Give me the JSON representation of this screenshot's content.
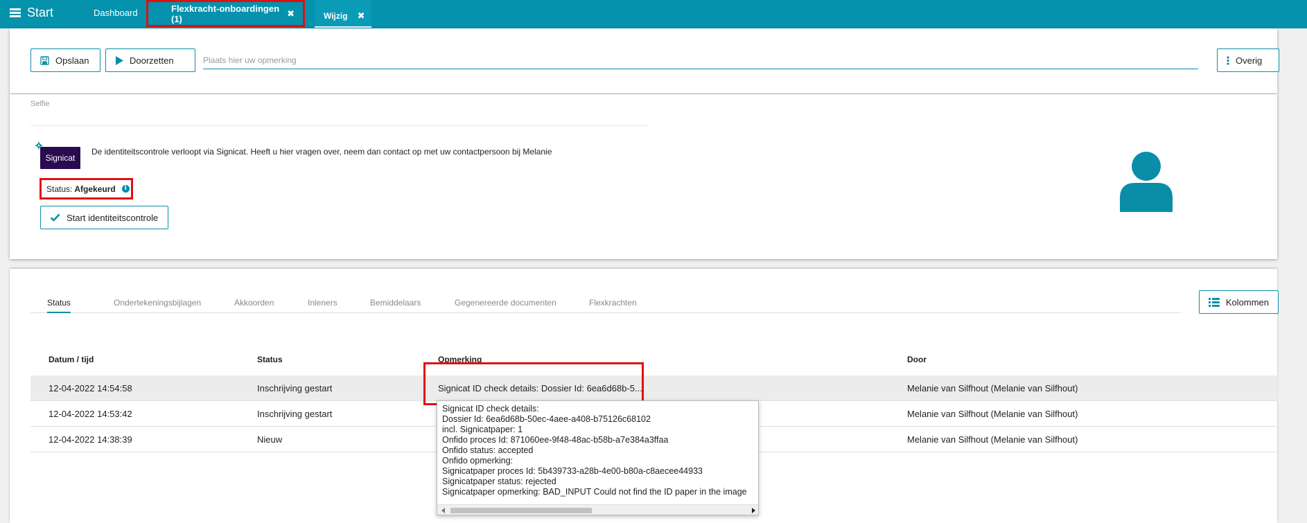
{
  "topbar": {
    "start_label": "Start",
    "tabs": [
      {
        "label": "Dashboard"
      },
      {
        "label": "Flexkracht-onboardingen (1)",
        "close": "✖"
      },
      {
        "label": "Wijzig",
        "close": "✖"
      }
    ],
    "bg_color": "#0492ad"
  },
  "toolbar": {
    "save_label": "Opslaan",
    "forward_label": "Doorzetten",
    "remark_placeholder": "Plaats hier uw opmerking",
    "more_label": "Overig"
  },
  "selfie": {
    "section_label": "Selfie",
    "logo_text": "Signicat",
    "info_text": "De identiteitscontrole verloopt via Signicat. Heeft u hier vragen over, neem dan contact op met uw contactpersoon bij Melanie",
    "status_label": "Status:",
    "status_value": "Afgekeurd",
    "start_button": "Start identiteitscontrole"
  },
  "detail_tabs": [
    {
      "label": "Status",
      "active": true
    },
    {
      "label": "Ondertekeningsbijlagen"
    },
    {
      "label": "Akkoorden"
    },
    {
      "label": "Inleners"
    },
    {
      "label": "Bemiddelaars"
    },
    {
      "label": "Gegenereerde documenten"
    },
    {
      "label": "Flexkrachten"
    }
  ],
  "columns_button": "Kolommen",
  "table": {
    "headers": [
      "Datum / tijd",
      "Status",
      "Opmerking",
      "Door"
    ],
    "rows": [
      {
        "datetime": "12-04-2022 14:54:58",
        "status": "Inschrijving gestart",
        "remark": "Signicat ID check details: Dossier Id: 6ea6d68b-5...",
        "by": "Melanie van Silfhout (Melanie van Silfhout)"
      },
      {
        "datetime": "12-04-2022 14:53:42",
        "status": "Inschrijving gestart",
        "remark": "",
        "by": "Melanie van Silfhout (Melanie van Silfhout)"
      },
      {
        "datetime": "12-04-2022 14:38:39",
        "status": "Nieuw",
        "remark": "",
        "by": "Melanie van Silfhout (Melanie van Silfhout)"
      }
    ]
  },
  "tooltip": {
    "lines": [
      "Signicat ID check details:",
      "Dossier Id: 6ea6d68b-50ec-4aee-a408-b75126c68102",
      "incl. Signicatpaper: 1",
      "Onfido proces Id: 871060ee-9f48-48ac-b58b-a7e384a3ffaa",
      "Onfido status: accepted",
      "Onfido opmerking:",
      "Signicatpaper proces Id: 5b439733-a28b-4e00-b80a-c8aecee44933",
      "Signicatpaper status: rejected",
      "Signicatpaper opmerking: BAD_INPUT Could not find the ID paper in the image"
    ]
  },
  "colors": {
    "accent": "#0a8ea8",
    "highlight_red": "#e01010",
    "signicat_purple": "#2a0a50"
  }
}
